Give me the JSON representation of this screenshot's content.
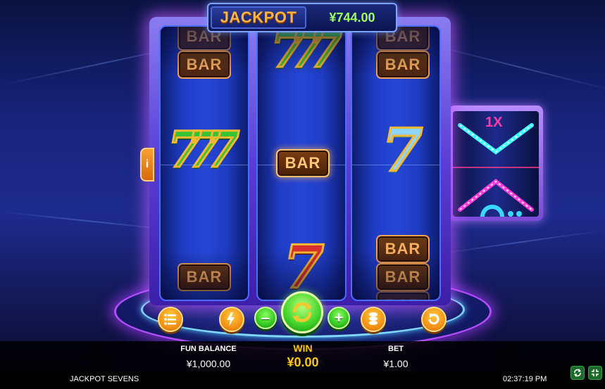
{
  "game": {
    "title": "JACKPOT SEVENS",
    "time": "02:37:19 PM"
  },
  "jackpot": {
    "label": "JACKPOT",
    "amount": "¥744.00"
  },
  "info_button": {
    "label": "i"
  },
  "reels": [
    {
      "symbols": [
        "BAR",
        "BAR",
        "777 (green)",
        "BAR"
      ]
    },
    {
      "symbols": [
        "777 (green)",
        "BAR",
        "7 (red)"
      ]
    },
    {
      "symbols": [
        "BAR",
        "BAR",
        "7 (blue)",
        "BAR",
        "BAR",
        "BAR"
      ]
    }
  ],
  "symbols": {
    "bar_text": "BAR",
    "seven_text": "7",
    "triple_seven_text": "777"
  },
  "controls": {
    "minus_label": "–",
    "plus_label": "+",
    "paytable_icon": "list-icon",
    "turbo_icon": "lightning-icon",
    "coins_icon": "coin-stack-icon",
    "autoplay_icon": "autoplay-icon",
    "spin_icon": "spin-arrows-icon"
  },
  "hud": {
    "balance_label": "FUN BALANCE",
    "balance_value": "¥1,000.00",
    "win_label": "WIN",
    "win_value": "¥0.00",
    "bet_label": "BET",
    "bet_value": "¥1.00"
  },
  "footer_buttons": [
    {
      "icon": "refresh-icon"
    },
    {
      "icon": "fullscreen-icon"
    }
  ],
  "colors": {
    "jackpot_label": "#ffb340",
    "jackpot_amount": "#9dff5a",
    "win": "#ffc800",
    "cabinet_glow": "#b34dff",
    "spin_green": "#3ed228"
  }
}
